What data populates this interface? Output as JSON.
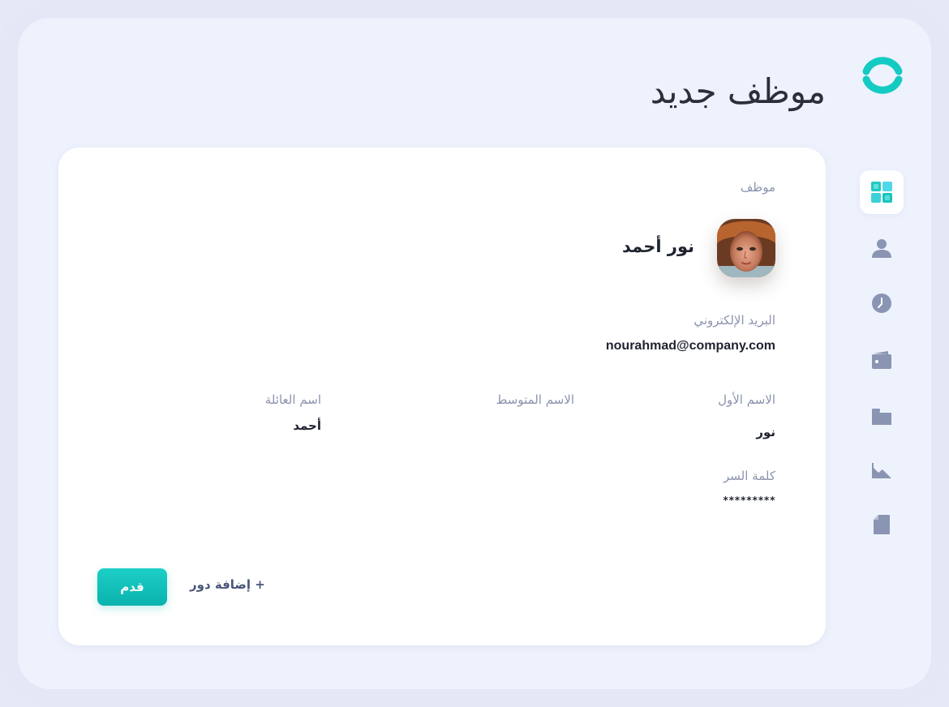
{
  "page": {
    "title": "موظف جديد"
  },
  "sidebar": {
    "items": [
      {
        "icon": "dashboard-icon",
        "active": true
      },
      {
        "icon": "user-icon",
        "active": false
      },
      {
        "icon": "clock-icon",
        "active": false
      },
      {
        "icon": "wallet-icon",
        "active": false
      },
      {
        "icon": "folder-icon",
        "active": false
      },
      {
        "icon": "chart-icon",
        "active": false
      },
      {
        "icon": "document-icon",
        "active": false
      }
    ]
  },
  "form": {
    "section_label": "موظف",
    "full_name": "نور أحمد",
    "email_label": "البريد الإلكتروني",
    "email_value": "nourahmad@company.com",
    "first_name_label": "الاسم الأول",
    "first_name_value": "نور",
    "middle_name_label": "الاسم المتوسط",
    "middle_name_value": "",
    "last_name_label": "اسم العائلة",
    "last_name_value": "أحمد",
    "password_label": "كلمة السر",
    "password_value": "*********",
    "add_role_label": "+ إضافة دور",
    "submit_label": "قدم"
  },
  "colors": {
    "accent": "#12c2bc",
    "icon_muted": "#8a95b3",
    "background": "#eef2fd"
  }
}
